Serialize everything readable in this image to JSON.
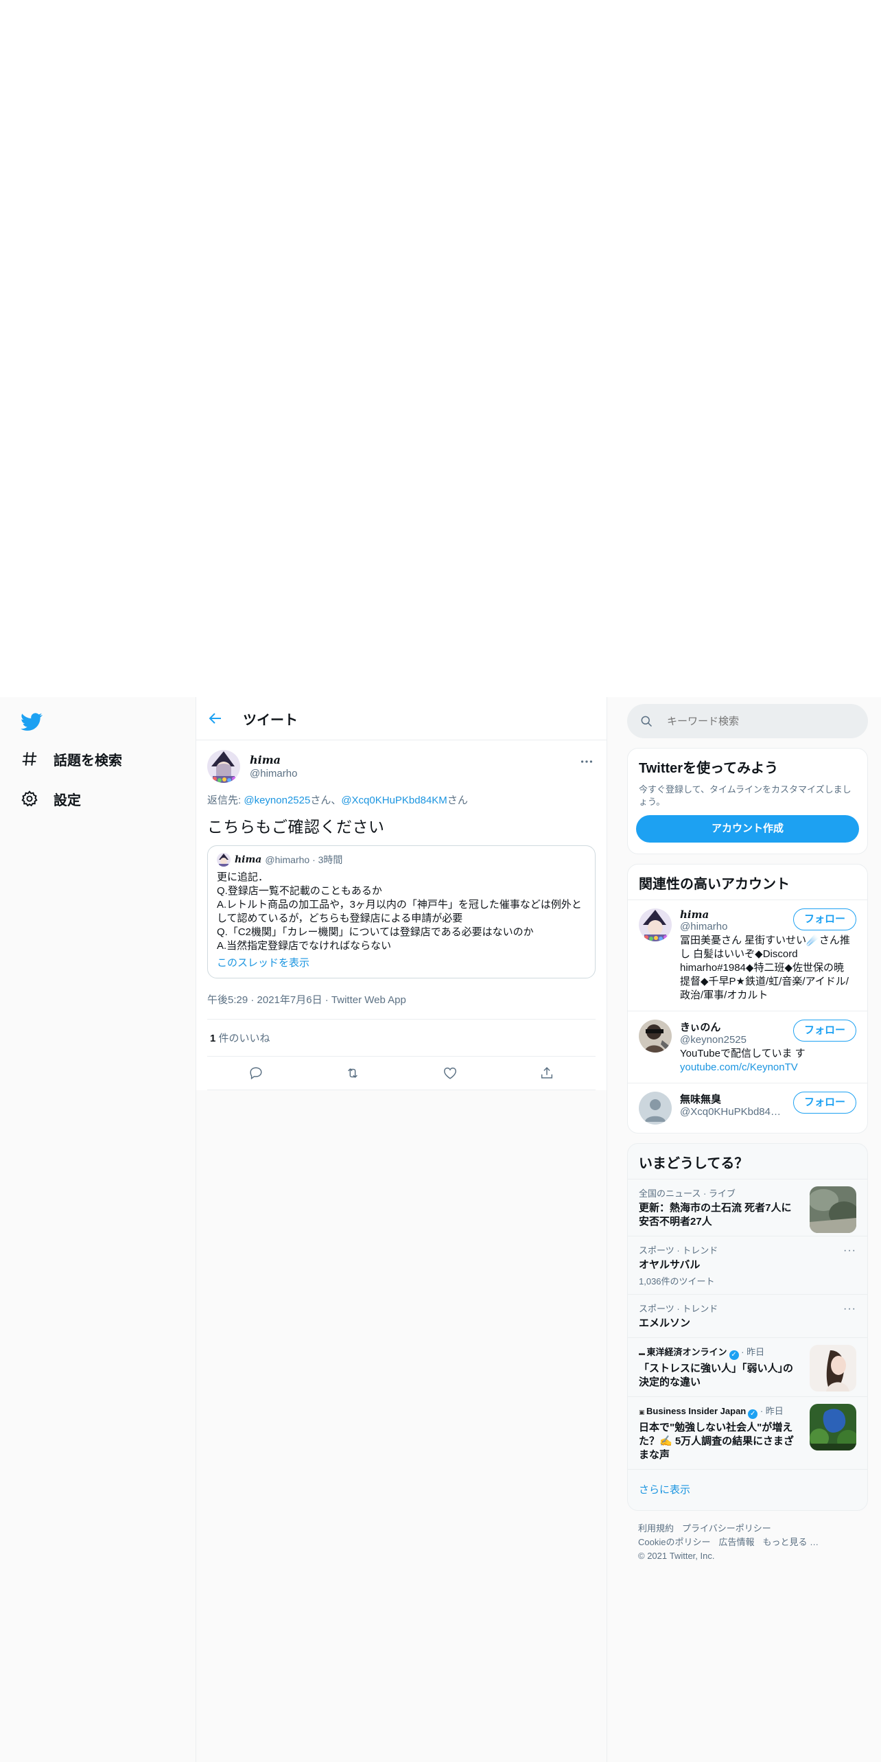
{
  "nav": {
    "explore_label": "話題を検索",
    "settings_label": "設定"
  },
  "header": {
    "title": "ツイート"
  },
  "tweet": {
    "display_name": "𝒉𝒊𝒎𝒂",
    "handle": "@himarho",
    "reply_prefix": "返信先: ",
    "reply_user1": "@keynon2525",
    "reply_suffix1": "さん、",
    "reply_user2": "@Xcq0KHuPKbd84KM",
    "reply_suffix2": "さん",
    "text": "こちらもご確認ください",
    "quote": {
      "display_name": "𝒉𝒊𝒎𝒂",
      "meta": "@himarho · 3時間",
      "lines": [
        "更に追記．",
        "Q.登録店一覧不記載のこともあるか",
        "A.レトルト商品の加工品や，3ヶ月以内の「神戸牛」を冠した催事などは例外と",
        "して認めているが，どちらも登録店による申請が必要",
        "Q.「C2機関」「カレー機関」については登録店である必要はないのか",
        "A.当然指定登録店でなければならない"
      ],
      "show_thread": "このスレッドを表示"
    },
    "timestamp": "午後5:29 · 2021年7月6日 · Twitter Web App",
    "likes_count": "1",
    "likes_label": " 件のいいね"
  },
  "search": {
    "placeholder": "キーワード検索"
  },
  "signup": {
    "title": "Twitterを使ってみよう",
    "desc": "今すぐ登録して、タイムラインをカスタマイズしましょう。",
    "button": "アカウント作成"
  },
  "related": {
    "title": "関連性の高いアカウント",
    "follow_label": "フォロー",
    "accounts": [
      {
        "name": "𝒉𝒊𝒎𝒂",
        "handle": "@himarho",
        "bio": "冨田美憂さん 星街すいせい☄️さん推し 白髪はいいぞ◆Discord himarho#1984◆特二班◆佐世保の暁 提督◆千早P★鉄道/虹/音楽/アイドル/政治/軍事/オカルト"
      },
      {
        "name": "きぃのん",
        "handle": "@keynon2525",
        "bio": "YouTubeで配信していま す",
        "link": "youtube.com/c/KeynonTV"
      },
      {
        "name": "無味無臭",
        "handle": "@Xcq0KHuPKbd84KM",
        "bio": ""
      }
    ]
  },
  "trends": {
    "title": "いまどうしてる？",
    "items": [
      {
        "category": "全国のニュース · ライブ",
        "title": "更新：熱海市の土石流 死者7人に 安否不明者27人"
      },
      {
        "category": "スポーツ · トレンド",
        "title": "オヤルサバル",
        "count": "1,036件のツイート"
      },
      {
        "category": "スポーツ · トレンド",
        "title": "エメルソン"
      },
      {
        "category": "東洋経済オンライン",
        "when": " · 昨日",
        "title": "「ストレスに強い人」｢弱い人｣の決定的な違い"
      },
      {
        "category": "Business Insider Japan",
        "when": " · 昨日",
        "title": "日本で\"勉強しない社会人\"が増えた？✍️ 5万人調査の結果にさまざまな声"
      }
    ],
    "show_more": "さらに表示"
  },
  "footer": {
    "terms": "利用規約",
    "privacy": "プライバシーポリシー",
    "cookie": "Cookieのポリシー",
    "ads": "広告情報",
    "more": "もっと見る …",
    "copyright": "© 2021 Twitter, Inc."
  },
  "colors": {
    "accent": "#1da1f2",
    "link": "#1b95e0",
    "secondary_text": "#5b7083"
  }
}
